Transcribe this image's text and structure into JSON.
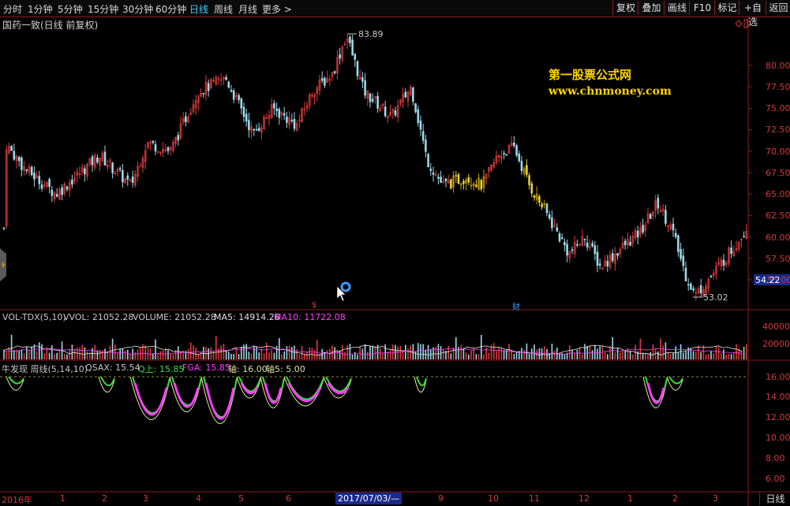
{
  "toolbar": {
    "timeframes": [
      "分时",
      "1分钟",
      "5分钟",
      "15分钟",
      "30分钟",
      "60分钟",
      "日线",
      "周线",
      "月线",
      "更多 >"
    ],
    "active": "日线",
    "right_buttons": [
      "复权",
      "叠加",
      "画线",
      "F10",
      "标记",
      "+自选",
      "返回"
    ]
  },
  "stock_title": "国药一致(日线 前复权)",
  "watermark": {
    "line1": "第一股票公式网",
    "line2": "www.chnmoney.com"
  },
  "price_axis": {
    "ticks": [
      "80.00",
      "77.50",
      "75.00",
      "72.50",
      "70.00",
      "67.50",
      "65.00",
      "62.50",
      "60.00",
      "57.50",
      "55.00"
    ],
    "current_price": "54.22",
    "high_label": "83.89",
    "low_label": "53.02"
  },
  "event_markers": {
    "s_marker": "$",
    "fin_marker": "财"
  },
  "volume_panel": {
    "header": {
      "name": "VOL-TDX(5,10)",
      "vvol": "VVOL: 21052.28",
      "volume": "VOLUME: 21052.28",
      "ma5": "MA5: 14914.26",
      "ma10": "MA10: 11722.08"
    },
    "ticks": [
      "40000",
      "20000"
    ]
  },
  "indicator_panel": {
    "header": {
      "name": "牛发现 周线(5,14,10)",
      "qsax": "QSAX: 15.54",
      "q_up": "Q上: 15.85",
      "fga": "FGA: 15.85",
      "axis1": "轴: 16.00",
      "axis5": "轴5: 5.00"
    },
    "ticks": [
      "16.00",
      "14.00",
      "12.00",
      "10.00",
      "8.00",
      "6.00"
    ]
  },
  "date_axis": {
    "labels": [
      "2016年",
      "1",
      "2",
      "3",
      "4",
      "5",
      "6",
      "9",
      "10",
      "11",
      "12",
      "1",
      "2",
      "3"
    ],
    "cursor_date": "2017/07/03/—",
    "right_button": "日线"
  },
  "colors": {
    "up": "#e03c3c",
    "down": "#9ed8e8",
    "axis": "#8a1a1a",
    "accent": "#3ad0ff",
    "watermark": "#ffd400",
    "magenta": "#ff3cff",
    "green": "#3cdc3c",
    "yellow": "#f0f0a0"
  }
}
